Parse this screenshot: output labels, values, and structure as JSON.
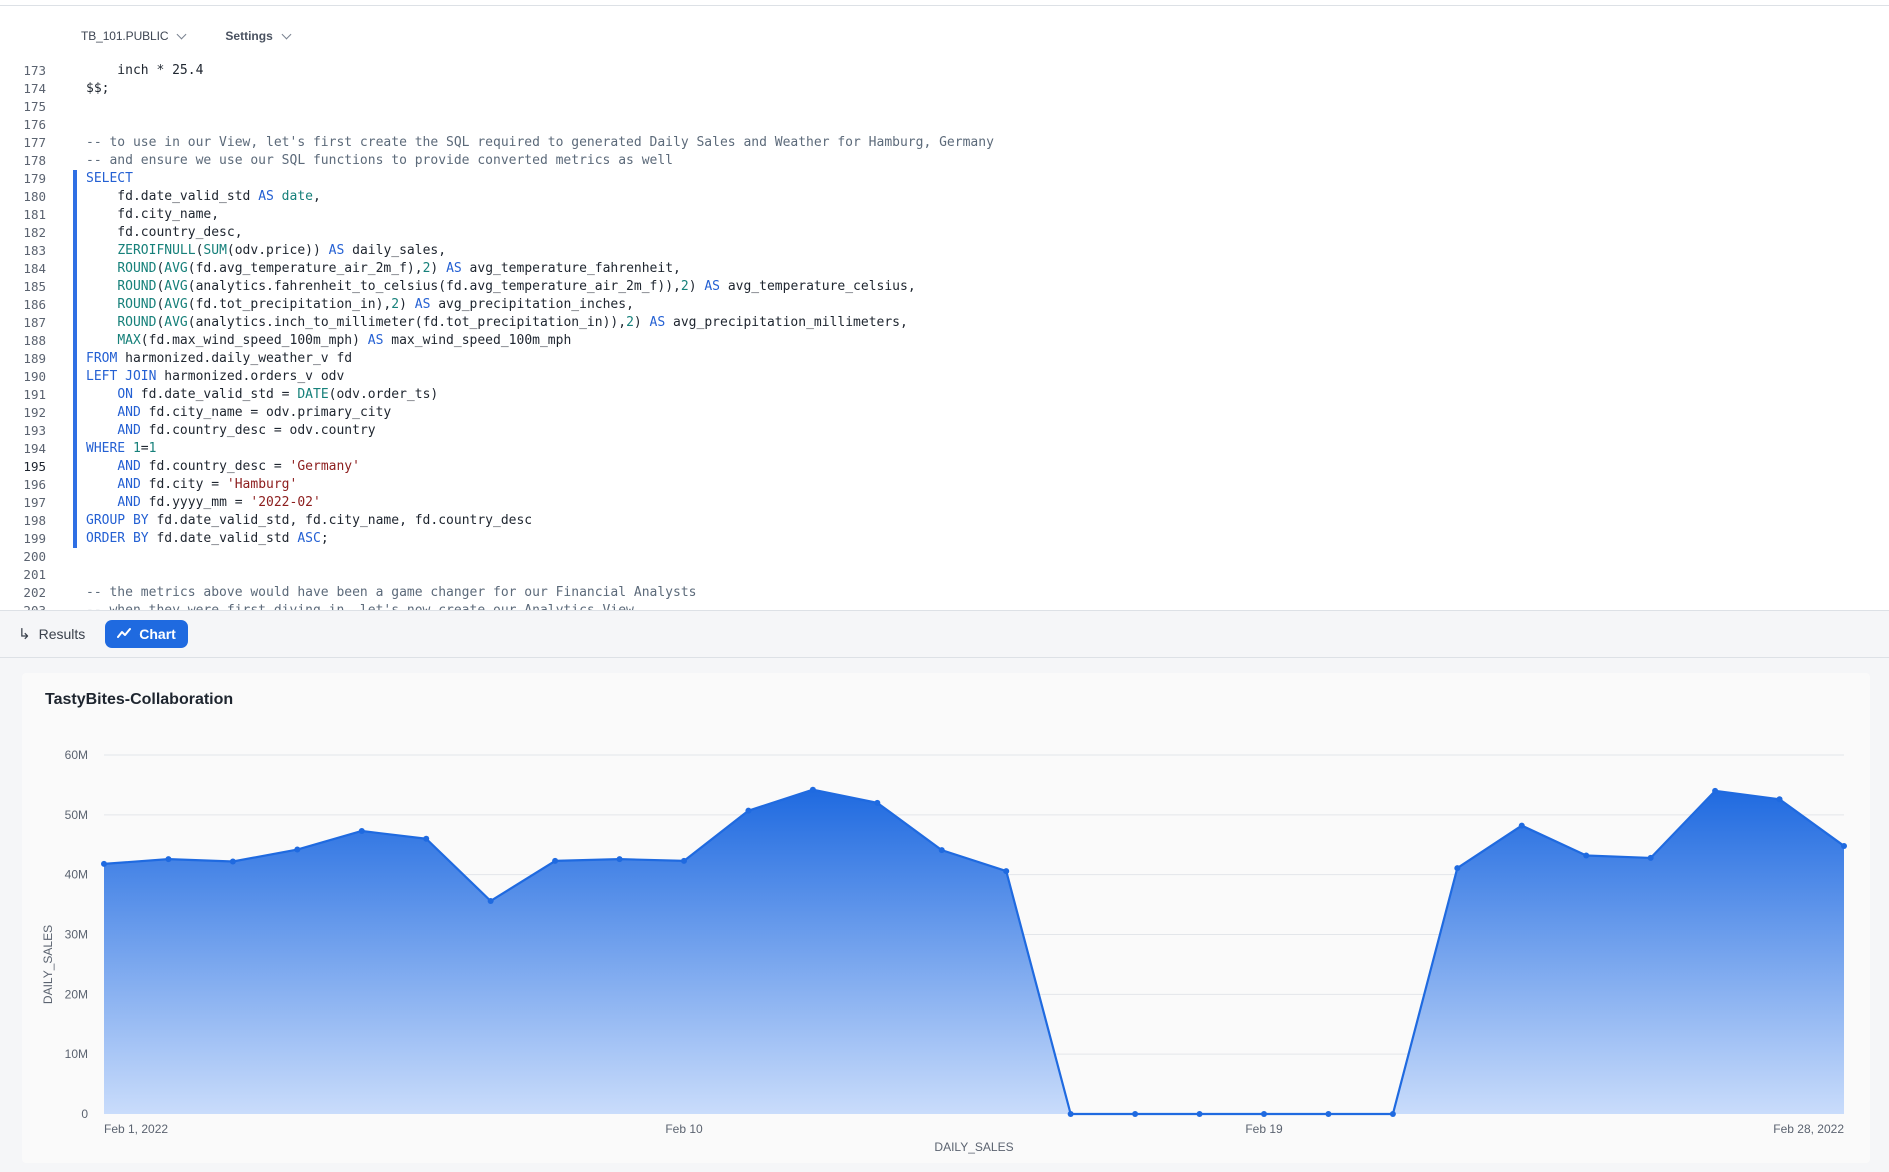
{
  "context": {
    "database": "TB_101.PUBLIC",
    "settings": "Settings"
  },
  "editor": {
    "active_line": "195",
    "lines": [
      {
        "n": "173",
        "t": [
          [
            "    inch * 25.4",
            ""
          ]
        ]
      },
      {
        "n": "174",
        "t": [
          [
            "$$;",
            ""
          ]
        ]
      },
      {
        "n": "175",
        "t": []
      },
      {
        "n": "176",
        "t": []
      },
      {
        "n": "177",
        "t": [
          [
            "-- to use in our View, let's first create the SQL required to generated Daily Sales and Weather for Hamburg, Germany",
            "cm"
          ]
        ]
      },
      {
        "n": "178",
        "t": [
          [
            "-- and ensure we use our SQL functions to provide converted metrics as well",
            "cm"
          ]
        ]
      },
      {
        "n": "179",
        "sel": true,
        "t": [
          [
            "SELECT",
            "kw"
          ]
        ]
      },
      {
        "n": "180",
        "sel": true,
        "t": [
          [
            "    fd.date_valid_std ",
            ""
          ],
          [
            "AS",
            "kw"
          ],
          [
            " ",
            ""
          ],
          [
            "date",
            "fn"
          ],
          [
            ",",
            ""
          ]
        ]
      },
      {
        "n": "181",
        "sel": true,
        "t": [
          [
            "    fd.city_name,",
            ""
          ]
        ]
      },
      {
        "n": "182",
        "sel": true,
        "t": [
          [
            "    fd.country_desc,",
            ""
          ]
        ]
      },
      {
        "n": "183",
        "sel": true,
        "t": [
          [
            "    ",
            ""
          ],
          [
            "ZEROIFNULL",
            "fn"
          ],
          [
            "(",
            ""
          ],
          [
            "SUM",
            "fn"
          ],
          [
            "(odv.price)) ",
            ""
          ],
          [
            "AS",
            "kw"
          ],
          [
            " daily_sales,",
            ""
          ]
        ]
      },
      {
        "n": "184",
        "sel": true,
        "t": [
          [
            "    ",
            ""
          ],
          [
            "ROUND",
            "fn"
          ],
          [
            "(",
            ""
          ],
          [
            "AVG",
            "fn"
          ],
          [
            "(fd.avg_temperature_air_2m_f),",
            ""
          ],
          [
            "2",
            "num"
          ],
          [
            ") ",
            ""
          ],
          [
            "AS",
            "kw"
          ],
          [
            " avg_temperature_fahrenheit,",
            ""
          ]
        ]
      },
      {
        "n": "185",
        "sel": true,
        "t": [
          [
            "    ",
            ""
          ],
          [
            "ROUND",
            "fn"
          ],
          [
            "(",
            ""
          ],
          [
            "AVG",
            "fn"
          ],
          [
            "(analytics.fahrenheit_to_celsius(fd.avg_temperature_air_2m_f)),",
            ""
          ],
          [
            "2",
            "num"
          ],
          [
            ") ",
            ""
          ],
          [
            "AS",
            "kw"
          ],
          [
            " avg_temperature_celsius,",
            ""
          ]
        ]
      },
      {
        "n": "186",
        "sel": true,
        "t": [
          [
            "    ",
            ""
          ],
          [
            "ROUND",
            "fn"
          ],
          [
            "(",
            ""
          ],
          [
            "AVG",
            "fn"
          ],
          [
            "(fd.tot_precipitation_in),",
            ""
          ],
          [
            "2",
            "num"
          ],
          [
            ") ",
            ""
          ],
          [
            "AS",
            "kw"
          ],
          [
            " avg_precipitation_inches,",
            ""
          ]
        ]
      },
      {
        "n": "187",
        "sel": true,
        "t": [
          [
            "    ",
            ""
          ],
          [
            "ROUND",
            "fn"
          ],
          [
            "(",
            ""
          ],
          [
            "AVG",
            "fn"
          ],
          [
            "(analytics.inch_to_millimeter(fd.tot_precipitation_in)),",
            ""
          ],
          [
            "2",
            "num"
          ],
          [
            ") ",
            ""
          ],
          [
            "AS",
            "kw"
          ],
          [
            " avg_precipitation_millimeters,",
            ""
          ]
        ]
      },
      {
        "n": "188",
        "sel": true,
        "t": [
          [
            "    ",
            ""
          ],
          [
            "MAX",
            "fn"
          ],
          [
            "(fd.max_wind_speed_100m_mph) ",
            ""
          ],
          [
            "AS",
            "kw"
          ],
          [
            " max_wind_speed_100m_mph",
            ""
          ]
        ]
      },
      {
        "n": "189",
        "sel": true,
        "t": [
          [
            "FROM",
            "kw"
          ],
          [
            " harmonized.daily_weather_v fd",
            ""
          ]
        ]
      },
      {
        "n": "190",
        "sel": true,
        "t": [
          [
            "LEFT JOIN",
            "kw"
          ],
          [
            " harmonized.orders_v odv",
            ""
          ]
        ]
      },
      {
        "n": "191",
        "sel": true,
        "t": [
          [
            "    ",
            ""
          ],
          [
            "ON",
            "kw"
          ],
          [
            " fd.date_valid_std = ",
            ""
          ],
          [
            "DATE",
            "fn"
          ],
          [
            "(odv.order_ts)",
            ""
          ]
        ]
      },
      {
        "n": "192",
        "sel": true,
        "t": [
          [
            "    ",
            ""
          ],
          [
            "AND",
            "kw"
          ],
          [
            " fd.city_name = odv.primary_city",
            ""
          ]
        ]
      },
      {
        "n": "193",
        "sel": true,
        "t": [
          [
            "    ",
            ""
          ],
          [
            "AND",
            "kw"
          ],
          [
            " fd.country_desc = odv.country",
            ""
          ]
        ]
      },
      {
        "n": "194",
        "sel": true,
        "t": [
          [
            "WHERE",
            "kw"
          ],
          [
            " ",
            ""
          ],
          [
            "1",
            "num"
          ],
          [
            "=",
            ""
          ],
          [
            "1",
            "num"
          ]
        ]
      },
      {
        "n": "195",
        "sel": true,
        "t": [
          [
            "    ",
            ""
          ],
          [
            "AND",
            "kw"
          ],
          [
            " fd.country_desc = ",
            ""
          ],
          [
            "'Germany'",
            "str"
          ]
        ]
      },
      {
        "n": "196",
        "sel": true,
        "t": [
          [
            "    ",
            ""
          ],
          [
            "AND",
            "kw"
          ],
          [
            " fd.city = ",
            ""
          ],
          [
            "'Hamburg'",
            "str"
          ]
        ]
      },
      {
        "n": "197",
        "sel": true,
        "t": [
          [
            "    ",
            ""
          ],
          [
            "AND",
            "kw"
          ],
          [
            " fd.yyyy_mm = ",
            ""
          ],
          [
            "'2022-02'",
            "str"
          ]
        ]
      },
      {
        "n": "198",
        "sel": true,
        "t": [
          [
            "GROUP BY",
            "kw"
          ],
          [
            " fd.date_valid_std, fd.city_name, fd.country_desc",
            ""
          ]
        ]
      },
      {
        "n": "199",
        "sel": true,
        "t": [
          [
            "ORDER BY",
            "kw"
          ],
          [
            " fd.date_valid_std ",
            ""
          ],
          [
            "ASC",
            "kw"
          ],
          [
            ";",
            ""
          ]
        ]
      },
      {
        "n": "200",
        "t": []
      },
      {
        "n": "201",
        "t": []
      },
      {
        "n": "202",
        "t": [
          [
            "-- the metrics above would have been a game changer for our Financial Analysts",
            "cm"
          ]
        ]
      },
      {
        "n": "203",
        "t": [
          [
            "-- when they were first diving in, let's now create our Analytics View",
            "cm"
          ]
        ]
      }
    ]
  },
  "results_bar": {
    "results_label": "Results",
    "chart_label": "Chart"
  },
  "chart_data": {
    "type": "area",
    "title": "TastyBites-Collaboration",
    "xlabel": "DAILY_SALES",
    "ylabel": "DAILY_SALES",
    "ylim": [
      0,
      60000000
    ],
    "yticks": [
      0,
      10000000,
      20000000,
      30000000,
      40000000,
      50000000,
      60000000
    ],
    "ytick_labels": [
      "0",
      "10M",
      "20M",
      "30M",
      "40M",
      "50M",
      "60M"
    ],
    "xtick_labels": [
      {
        "day": 1,
        "label": "Feb 1, 2022",
        "align": "start"
      },
      {
        "day": 10,
        "label": "Feb 10",
        "align": "middle"
      },
      {
        "day": 19,
        "label": "Feb 19",
        "align": "middle"
      },
      {
        "day": 28,
        "label": "Feb 28, 2022",
        "align": "end"
      }
    ],
    "x_dates": [
      "2022-02-01",
      "2022-02-02",
      "2022-02-03",
      "2022-02-04",
      "2022-02-05",
      "2022-02-06",
      "2022-02-07",
      "2022-02-08",
      "2022-02-09",
      "2022-02-10",
      "2022-02-11",
      "2022-02-12",
      "2022-02-13",
      "2022-02-14",
      "2022-02-15",
      "2022-02-16",
      "2022-02-17",
      "2022-02-18",
      "2022-02-19",
      "2022-02-20",
      "2022-02-21",
      "2022-02-22",
      "2022-02-23",
      "2022-02-24",
      "2022-02-25",
      "2022-02-26",
      "2022-02-27",
      "2022-02-28"
    ],
    "values": [
      41800000,
      42600000,
      42200000,
      44200000,
      47300000,
      46000000,
      35600000,
      42300000,
      42600000,
      42300000,
      50700000,
      54200000,
      52000000,
      44100000,
      40600000,
      0,
      0,
      0,
      0,
      0,
      0,
      41100000,
      48200000,
      43200000,
      42800000,
      54000000,
      52600000,
      44800000
    ],
    "grid": true,
    "color": "#1f6ae0"
  }
}
